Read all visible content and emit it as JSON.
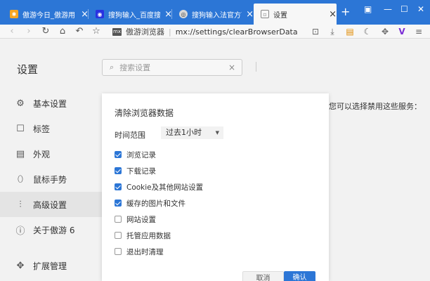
{
  "tabs": [
    {
      "label": "傲游今日_傲游用",
      "icon": "maxthon-today-icon",
      "icon_color": "#f5a623"
    },
    {
      "label": "搜狗输入_百度搜",
      "icon": "baidu-icon",
      "icon_color": "#2932e1"
    },
    {
      "label": "搜狗输入法官方下",
      "icon": "globe-icon",
      "icon_color": "#4a4a4a"
    },
    {
      "label": "设置",
      "icon": "settings-tab-icon",
      "icon_color": "#888888"
    }
  ],
  "address": {
    "badge": "mx",
    "app_name": "傲游浏览器",
    "url": "mx://settings/clearBrowserData"
  },
  "settings": {
    "title": "设置",
    "search_placeholder": "搜索设置",
    "sidebar": [
      {
        "label": "基本设置",
        "icon": "gear-icon"
      },
      {
        "label": "标签",
        "icon": "tab-icon"
      },
      {
        "label": "外观",
        "icon": "appearance-icon"
      },
      {
        "label": "鼠标手势",
        "icon": "mouse-icon"
      },
      {
        "label": "高级设置",
        "icon": "sliders-icon"
      },
      {
        "label": "关于傲游 6",
        "icon": "info-icon"
      },
      {
        "label": "扩展管理",
        "icon": "puzzle-icon"
      }
    ],
    "background_text": "您可以选择禁用这些服务："
  },
  "dialog": {
    "title": "清除浏览器数据",
    "range_label": "时间范围",
    "range_value": "过去1小时",
    "options": [
      {
        "label": "浏览记录",
        "checked": true
      },
      {
        "label": "下载记录",
        "checked": true
      },
      {
        "label": "Cookie及其他网站设置",
        "checked": true
      },
      {
        "label": "缓存的图片和文件",
        "checked": true
      },
      {
        "label": "网站设置",
        "checked": false
      },
      {
        "label": "托管应用数据",
        "checked": false
      },
      {
        "label": "退出时清理",
        "checked": false
      }
    ],
    "cancel_label": "取消",
    "ok_label": "确认"
  },
  "colors": {
    "accent": "#2c76d6"
  }
}
